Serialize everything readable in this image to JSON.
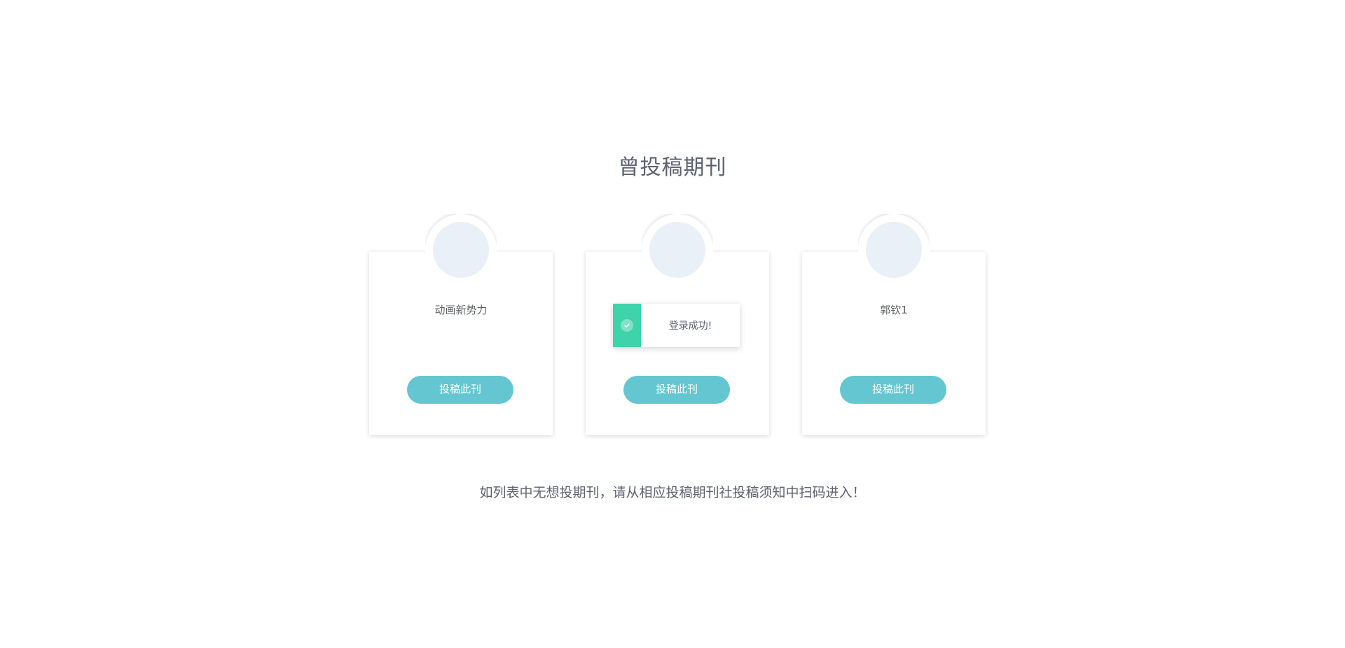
{
  "page": {
    "title": "曾投稿期刊",
    "hint": "如列表中无想投期刊，请从相应投稿期刊社投稿须知中扫码进入！"
  },
  "journals": [
    {
      "name": "动画新势力",
      "button_label": "投稿此刊"
    },
    {
      "name": "",
      "button_label": "投稿此刊"
    },
    {
      "name": "郭钦1",
      "button_label": "投稿此刊"
    }
  ],
  "toast": {
    "message": "登录成功!",
    "type": "success",
    "icon": "check-circle-icon",
    "accent_color": "#3fd3ab"
  },
  "colors": {
    "button": "#63c6d0",
    "avatar_placeholder": "#eaf0f7",
    "text": "#5d6270"
  }
}
